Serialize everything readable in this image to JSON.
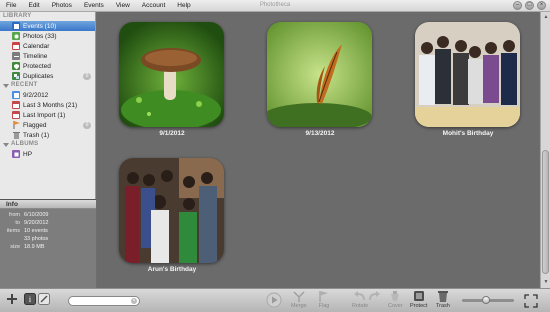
{
  "window": {
    "title": "Phototheca"
  },
  "menu": [
    "File",
    "Edit",
    "Photos",
    "Events",
    "View",
    "Account",
    "Help"
  ],
  "sidebar": {
    "library_header": "LIBRARY",
    "library": [
      {
        "label": "Events (10)",
        "selected": true,
        "icon": "events-icon",
        "color": "#4a90e2"
      },
      {
        "label": "Photos (33)",
        "icon": "photos-icon",
        "color": "#58a64b"
      },
      {
        "label": "Calendar",
        "icon": "calendar-icon",
        "color": "#d04444"
      },
      {
        "label": "Timeline",
        "icon": "timeline-icon",
        "color": "#7d7d7d"
      },
      {
        "label": "Protected",
        "icon": "protected-icon",
        "color": "#3e8a3e"
      },
      {
        "label": "Duplicates",
        "icon": "duplicates-icon",
        "color": "#3e8a3e",
        "badge": "0"
      }
    ],
    "recent_header": "RECENT",
    "recent": [
      {
        "label": "9/2/2012",
        "icon": "event-icon",
        "color": "#4a90e2"
      },
      {
        "label": "Last 3 Months (21)",
        "icon": "recent-icon",
        "color": "#c24a4a"
      },
      {
        "label": "Last Import (1)",
        "icon": "import-icon",
        "color": "#c24a4a"
      },
      {
        "label": "Flagged",
        "icon": "flag-icon",
        "color": "#e0903a",
        "badge": "0"
      },
      {
        "label": "Trash (1)",
        "icon": "trash-icon",
        "color": "#8a8a8a"
      }
    ],
    "albums_header": "ALBUMS",
    "albums": [
      {
        "label": "HP",
        "icon": "album-icon",
        "color": "#8a5fb0"
      }
    ]
  },
  "info": {
    "header": "Info",
    "rows": [
      {
        "label": "from",
        "value": "6/10/2009"
      },
      {
        "label": "to",
        "value": "9/20/2012"
      },
      {
        "label": "items",
        "value": "10 events"
      },
      {
        "label": "",
        "value": "33 photos"
      },
      {
        "label": "size",
        "value": "18.9 MB"
      }
    ]
  },
  "events": [
    {
      "label": "9/1/2012",
      "thumb": "mushroom-photo"
    },
    {
      "label": "9/13/2012",
      "thumb": "butterfly-photo"
    },
    {
      "label": "Mohit's Birthday",
      "thumb": "group-photo"
    },
    {
      "label": "Arun's Birthday",
      "thumb": "party-photo"
    }
  ],
  "toolbar": {
    "buttons": [
      {
        "label": "Merge",
        "icon": "merge-icon"
      },
      {
        "label": "Flag",
        "icon": "flag-icon"
      },
      {
        "label": "Rotate",
        "icon": "rotate-left-icon"
      },
      {
        "label": "Cover",
        "icon": "cover-icon"
      },
      {
        "label": "Protect",
        "icon": "protect-icon"
      },
      {
        "label": "Trash",
        "icon": "trash-icon"
      }
    ],
    "search_placeholder": ""
  },
  "colors": {
    "accent": "#3a78c9",
    "background": "#6b6b6b"
  }
}
